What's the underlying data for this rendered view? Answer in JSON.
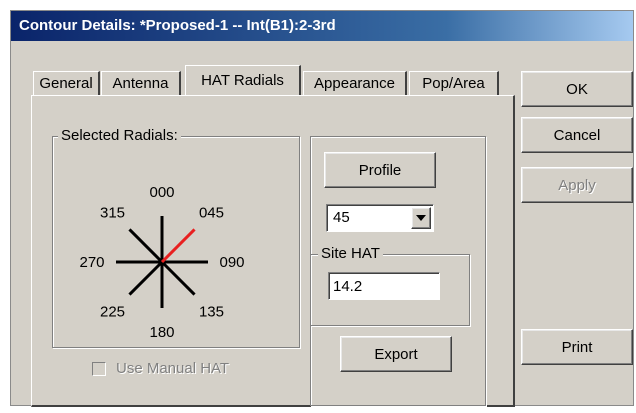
{
  "window": {
    "title": "Contour Details: *Proposed-1 -- Int(B1):2-3rd"
  },
  "tabs": [
    {
      "label": "General"
    },
    {
      "label": "Antenna"
    },
    {
      "label": "HAT Radials"
    },
    {
      "label": "Appearance"
    },
    {
      "label": "Pop/Area"
    }
  ],
  "active_tab": "HAT Radials",
  "selected_radials": {
    "label": "Selected Radials:",
    "directions": [
      "000",
      "045",
      "090",
      "135",
      "180",
      "225",
      "270",
      "315"
    ],
    "highlighted": "045",
    "highlight_color": "#e82020",
    "line_color": "#000000"
  },
  "profile": {
    "button_label": "Profile",
    "radial_select_value": "45"
  },
  "site_hat": {
    "label": "Site HAT",
    "value": "14.2"
  },
  "use_manual_hat": {
    "label": "Use Manual HAT",
    "checked": false,
    "enabled": false
  },
  "buttons": {
    "ok": "OK",
    "cancel": "Cancel",
    "apply": "Apply",
    "export": "Export",
    "print": "Print"
  },
  "colors": {
    "dialog_bg": "#d4d0c8",
    "title_start": "#0a246a",
    "title_end": "#a6caf0"
  }
}
